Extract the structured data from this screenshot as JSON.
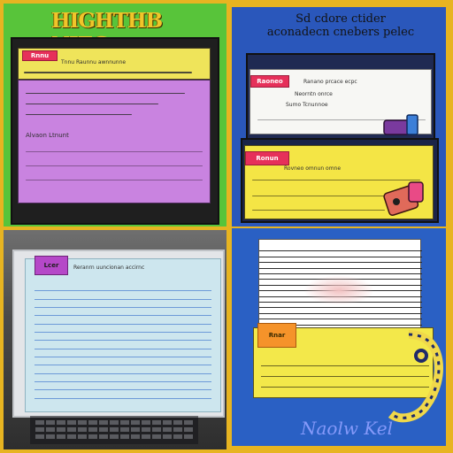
{
  "panel_1": {
    "title": "HIGHTHB NIEG",
    "tag": "Rnnu",
    "heading": "Tnnu Raunnu awnnunne",
    "lines": [
      "",
      "",
      "",
      "Alvaon Ltnunt"
    ]
  },
  "panel_2": {
    "title_line1": "Sd cdore ctider",
    "title_line2": "aconadecn cnebers pelec",
    "top_tag": "Raoneo",
    "top_lines": [
      "Ranano prcace ecpc",
      "Neorntn onrce",
      "Sumo Tcnunnoe"
    ],
    "bottom_tag": "Ronun",
    "bottom_heading": "Rovneo omnun omne",
    "bottom_lines": [
      "",
      "",
      ""
    ]
  },
  "panel_3": {
    "tag": "Lcer",
    "heading": "Reranrn uuncionan accirnc",
    "ruled_lines": 14
  },
  "panel_4": {
    "tag": "Rnar",
    "signature": "Naolw Kel",
    "top_lines": 14,
    "bottom_lines": 3
  },
  "colors": {
    "panel_1_bg": "#58c43a",
    "panel_2_bg": "#2a57bb",
    "panel_4_bg": "#2a60c4",
    "sticky_yellow": "#efe45a",
    "sticky_purple": "#c983e0",
    "tag_red": "#e6305a",
    "tag_orange": "#f5932a",
    "border_gold": "#e7b421"
  }
}
